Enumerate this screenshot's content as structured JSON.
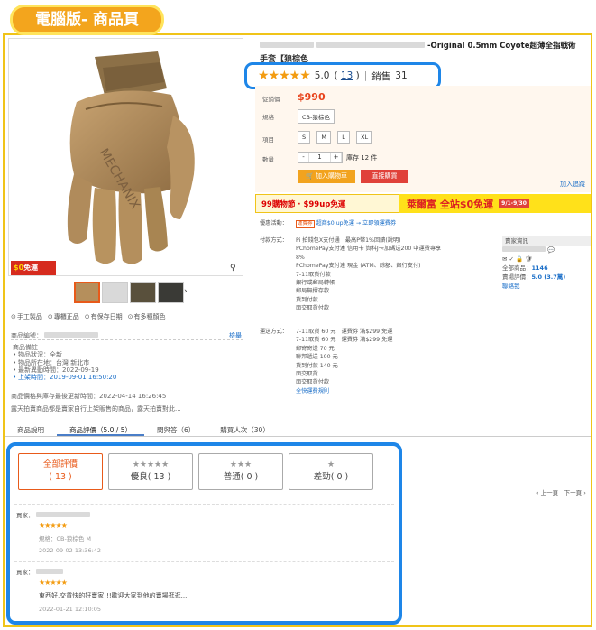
{
  "header_tag": "電腦版- 商品頁",
  "product": {
    "title_suffix": "-Original 0.5mm Coyote超薄全指戰術",
    "subtitle": "手套【狼棕色",
    "rating_value": "5.0",
    "rating_count": "13",
    "sold_label": "銷售",
    "sold_count": "31",
    "price_label": "促銷價",
    "price": "$990",
    "spec_label": "規格",
    "spec_value": "CB-狼棕色",
    "size_label": "項目",
    "sizes": [
      "S",
      "M",
      "L",
      "XL"
    ],
    "qty_label": "數量",
    "qty_minus": "-",
    "qty_value": "1",
    "qty_plus": "+",
    "stock": "庫存 12 件",
    "add_cart": "加入購物車",
    "buy_now": "直接購買",
    "add_fav": "加入追蹤",
    "free_badge_pre": "$",
    "free_badge_num": "0",
    "free_badge_post": "免運",
    "zoom_icon": "⚲",
    "thumb_next": "›"
  },
  "promo": {
    "left": "99購物節 · $99up免運",
    "right": "萊爾富 全站$0免運",
    "right_note": "9/1-9/30"
  },
  "info": {
    "discount_label": "優惠活動：",
    "discount_tag": "運費券",
    "discount_text": "超商$0 up免運 → 立即領運費券",
    "payment_label": "付款方式：",
    "payments": [
      "Pi 拍錢包X支付通　最高P幣1%回饋(說明)",
      "PChomePay支付連 信用卡 資料J卡加碼送200 中運費專享",
      "8%",
      "PChomePay支付連 現金 (ATM、餘額、銀行支付)",
      "7-11取貨付款",
      "銀行或郵局轉帳",
      "郵局無摺存款",
      "貨到付款",
      "面交取貨付款"
    ],
    "ship_label": "運送方式：",
    "ships": [
      "7-11取貨 60 元　運費券 滿$299 免運",
      "7-11取貨 60 元　運費券 滿$299 免運",
      "郵寄寄送 70 元",
      "聯邦遞送 100 元",
      "貨到付款 140 元",
      "面交取貨",
      "面交取貨付款",
      "全快運費規則"
    ]
  },
  "seller": {
    "header": "賣家資訊",
    "total_label": "全部商品：",
    "total": "1146",
    "score_label": "賣場評價：",
    "score": "5.0 (3.7萬)",
    "contact": "聯絡我"
  },
  "left": {
    "links": [
      "手工製品",
      "專櫃正品",
      "有保存日期",
      "有多種顏色"
    ],
    "prod_no_label": "商品編號：",
    "report": "檢舉",
    "notes_title": "商品備註",
    "notes": [
      "物品狀況：全新",
      "物品所在地：台灣 新北市",
      "最新異動時間：2022-09-19",
      "上架時間：2019-09-01 16:50:20"
    ],
    "update": "商品價格與庫存最後更新時間：2022-04-14 16:26:45",
    "note2": "露天拍賣商品都是賣家自行上架販售的商品，露天拍賣對此..."
  },
  "tabs": [
    "商品說明",
    "商品評價（5.0 / 5）",
    "問與答（6）",
    "購買人次（30）"
  ],
  "filters": [
    {
      "stars": "",
      "label": "全部評價",
      "count": "( 13 )"
    },
    {
      "stars": "★★★★★",
      "label": "優良",
      "count": "( 13 )"
    },
    {
      "stars": "★★★",
      "label": "普通",
      "count": "( 0 )"
    },
    {
      "stars": "★",
      "label": "差勁",
      "count": "( 0 )"
    }
  ],
  "pager": "‹ 上一頁　下一頁 ›",
  "reviews": [
    {
      "buyer_label": "買家：",
      "stars": "★★★★★",
      "spec": "規格：CB-狼棕色 M",
      "date": "2022-09-02 13:36:42",
      "text": ""
    },
    {
      "buyer_label": "買家：",
      "stars": "★★★★★",
      "spec": "",
      "date": "2022-01-21 12:10:05",
      "text": "東西好,交貨快的好賣家!!!歡迎大家到他的賣場逛逛..."
    }
  ]
}
